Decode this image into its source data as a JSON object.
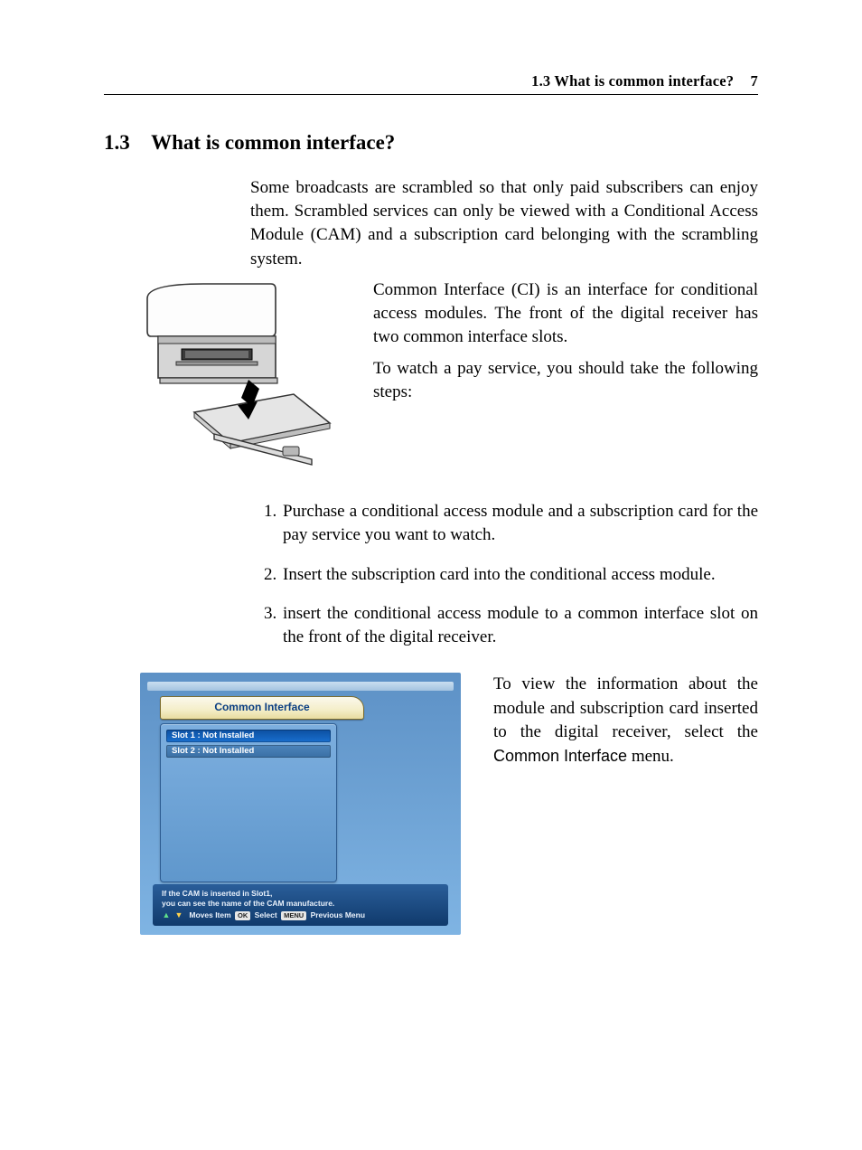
{
  "header": {
    "running_head": "1.3 What is common interface?",
    "page_number": "7"
  },
  "section": {
    "number": "1.3",
    "title": "What is common interface?"
  },
  "paragraphs": {
    "intro": "Some broadcasts are scrambled so that only paid subscribers can enjoy them. Scrambled services can only be viewed with a Conditional Access Module (CAM) and a subscription card belonging with the scrambling system.",
    "ci_desc": "Common Interface (CI) is an interface for conditional access modules. The front of the digital receiver has two common interface slots.",
    "steps_lead": "To watch a pay service, you should take the following steps:",
    "view_info_pre": "To view the information about the module and subscription card inserted to the digital receiver, select the ",
    "view_info_menu": "Common Interface",
    "view_info_post": " menu."
  },
  "steps": [
    "Purchase a conditional access module and a subscription card for the pay service you want to watch.",
    "Insert the subscription card into the conditional access module.",
    "insert the conditional access module to a common interface slot on the front of the digital receiver."
  ],
  "ci_screenshot": {
    "title": "Common Interface",
    "slot1": "Slot 1 : Not Installed",
    "slot2": "Slot 2 : Not Installed",
    "help_line1": "If the CAM is inserted in Slot1,",
    "help_line2": "you can see the name of the CAM manufacture.",
    "nav_moves": "Moves Item",
    "nav_ok": "OK",
    "nav_select": "Select",
    "nav_menu": "MENU",
    "nav_prev": "Previous Menu"
  }
}
